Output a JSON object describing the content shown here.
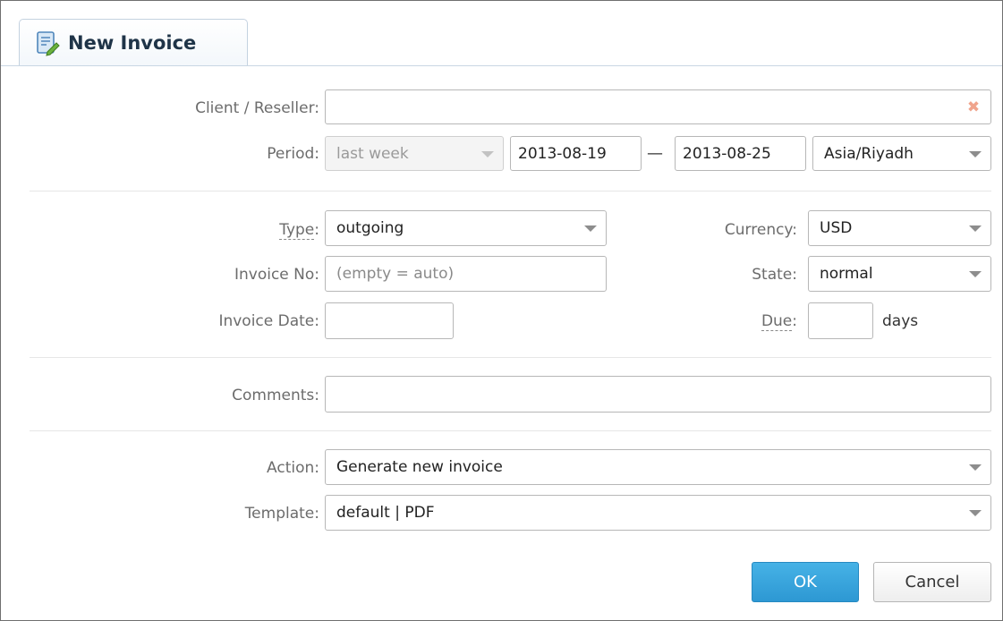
{
  "window": {
    "tab_title": "New Invoice",
    "tab_icon": "invoice-edit-icon"
  },
  "form": {
    "client": {
      "label": "Client / Reseller:",
      "value": "",
      "clear_icon": "clear-x-icon",
      "clear_color": "#f0a48c"
    },
    "period": {
      "label": "Period:",
      "preset": "last week",
      "from": "2013-08-19",
      "separator": "—",
      "to": "2013-08-25",
      "timezone": "Asia/Riyadh"
    },
    "type": {
      "label_word": "Type",
      "label_colon": ":",
      "value": "outgoing"
    },
    "currency": {
      "label": "Currency:",
      "value": "USD"
    },
    "invoice_no": {
      "label": "Invoice No:",
      "value": "",
      "placeholder": "(empty = auto)"
    },
    "state": {
      "label": "State:",
      "value": "normal"
    },
    "invoice_date": {
      "label": "Invoice Date:",
      "value": ""
    },
    "due": {
      "label_word": "Due",
      "label_colon": ":",
      "value": "",
      "suffix": "days"
    },
    "comments": {
      "label": "Comments:",
      "value": ""
    },
    "action": {
      "label": "Action:",
      "value": "Generate new invoice"
    },
    "template": {
      "label": "Template:",
      "value": "default | PDF"
    }
  },
  "buttons": {
    "ok": "OK",
    "cancel": "Cancel"
  },
  "colors": {
    "ok_button": "#2d98d3",
    "tab_border": "#c4d2e0",
    "label_text": "#6c6c6c"
  }
}
